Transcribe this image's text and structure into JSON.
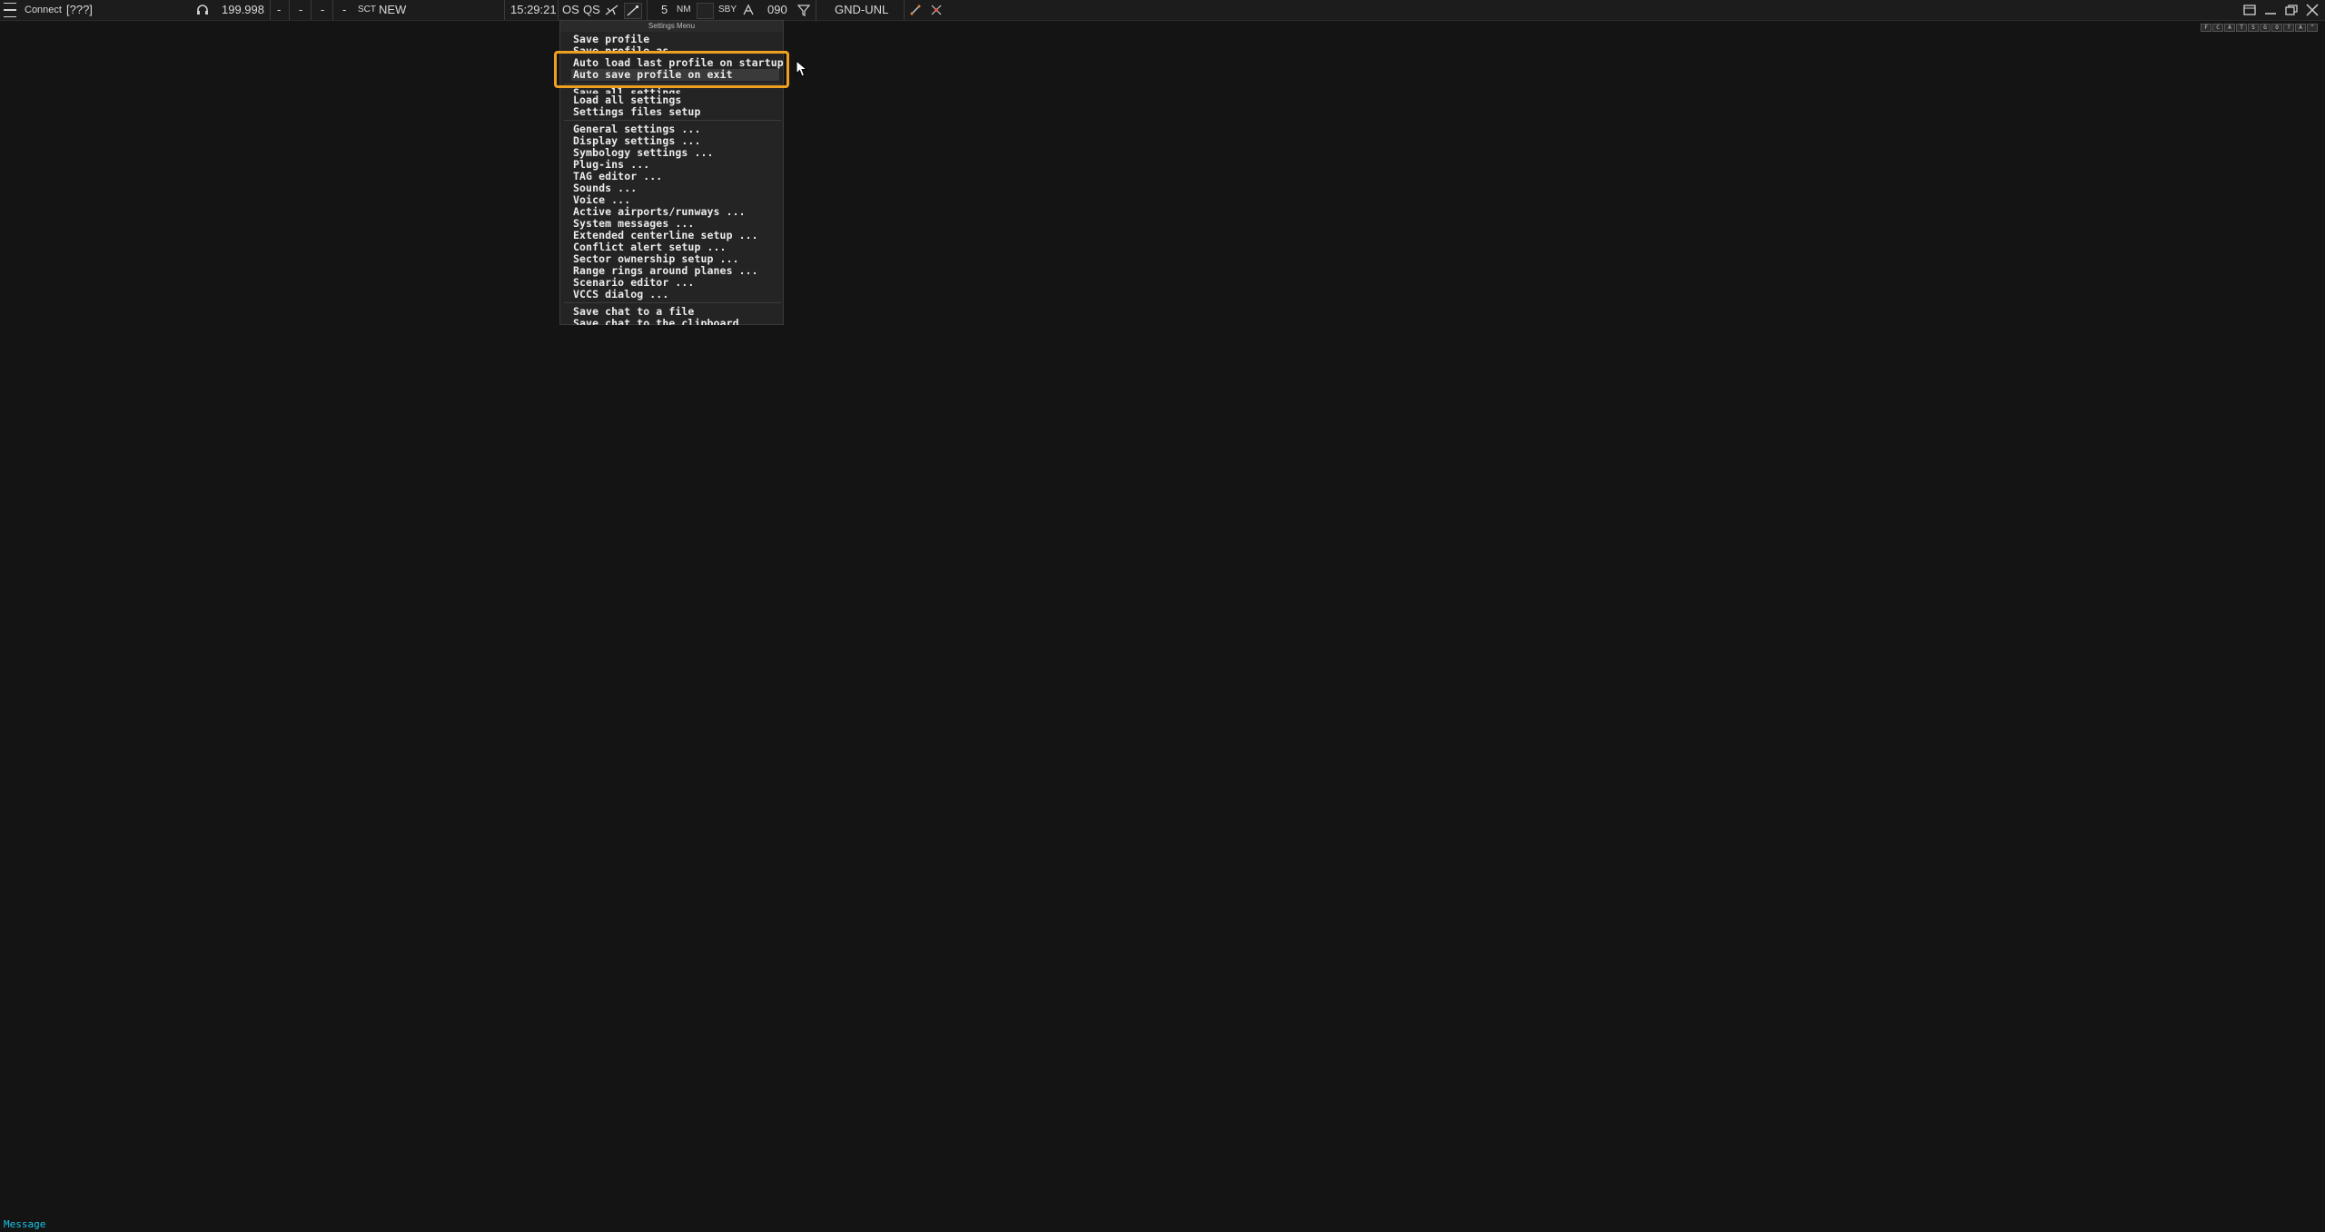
{
  "topbar": {
    "connect_label": "Connect",
    "callsign": "[???]",
    "frequency": "199.998",
    "dash1": "-",
    "dash2": "-",
    "dash3": "-",
    "dash4": "-",
    "sct_label": "SCT",
    "sct_value": "NEW",
    "time": "15:29:21",
    "os_label": "OS",
    "qs_label": "QS",
    "range_value": "5",
    "range_unit": "NM",
    "sby_label": "SBY",
    "heading": "090",
    "position": "GND-UNL"
  },
  "icons": {
    "menu": "hamburger-icon",
    "headset": "headset-icon",
    "plane": "plane-icon",
    "line": "line-tool-icon",
    "filter": "filter-icon",
    "restore": "restore-icon",
    "minimize": "minimize-icon",
    "maximize": "maximize-icon",
    "close": "close-icon"
  },
  "settings_menu": {
    "title": "Settings Menu",
    "items": [
      "Save profile",
      "Save profile as",
      "Auto load last profile on startup",
      "Auto save profile on exit",
      "Save all settings",
      "Load all settings",
      "Settings files setup",
      "General settings ...",
      "Display settings ...",
      "Symbology settings ...",
      "Plug-ins ...",
      "TAG editor ...",
      "Sounds ...",
      "Voice ...",
      "Active airports/runways ...",
      "System messages ...",
      "Extended centerline setup ...",
      "Conflict alert setup ...",
      "Sector ownership setup ...",
      "Range rings around planes ...",
      "Scenario editor ...",
      "VCCS dialog ...",
      "Save chat to a file",
      "Save chat to the clipboard"
    ]
  },
  "strip_labels": [
    "F",
    "C",
    "A",
    "T",
    "S",
    "G",
    "O",
    "?",
    "A",
    "^"
  ],
  "message_label": "Message",
  "colors": {
    "background": "#141414",
    "highlight_border": "#f0a020",
    "message": "#19c6e8"
  }
}
